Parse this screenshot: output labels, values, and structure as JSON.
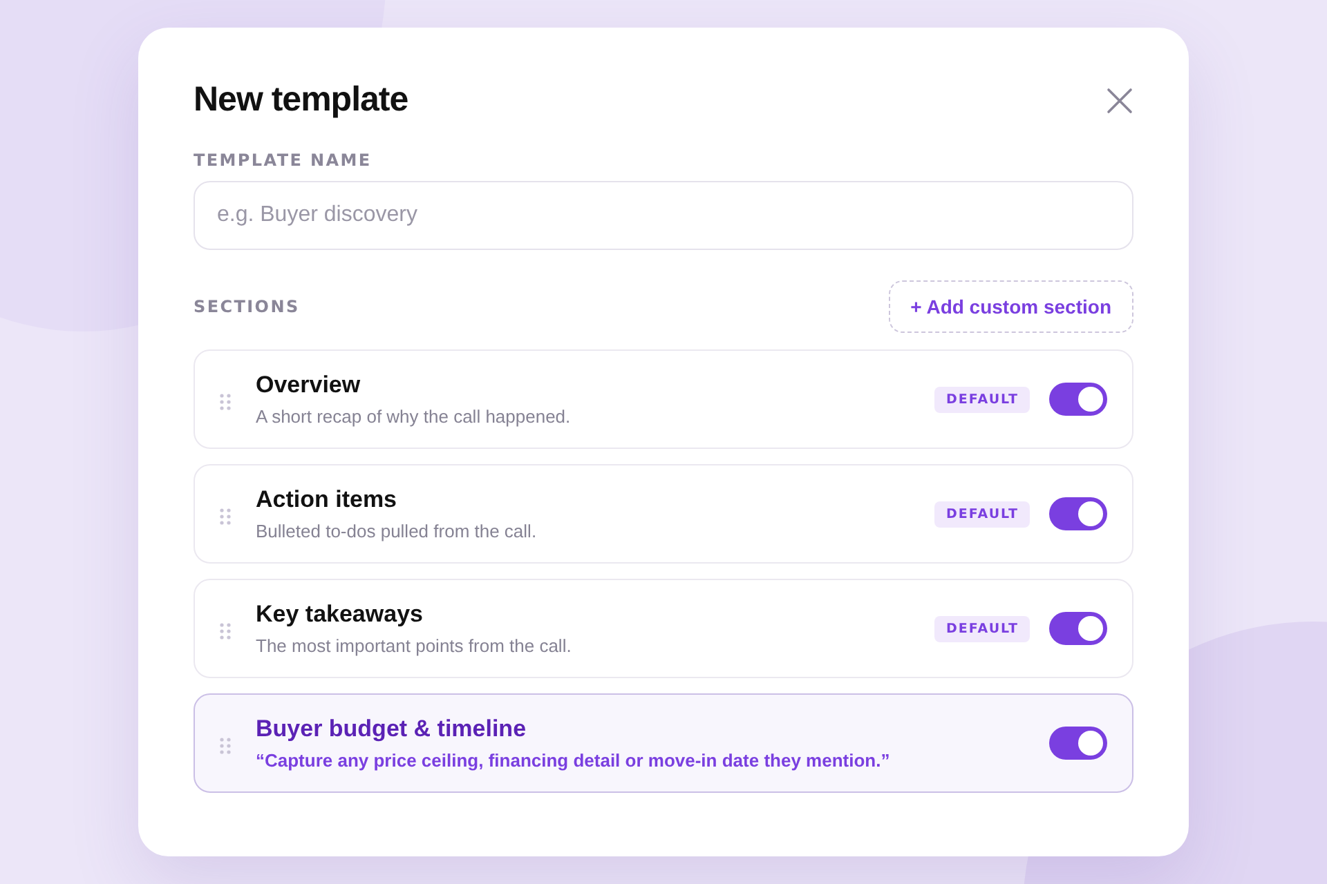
{
  "dialog": {
    "title": "New template"
  },
  "template_name": {
    "label": "TEMPLATE NAME",
    "placeholder": "e.g. Buyer discovery"
  },
  "sections_header": {
    "label": "SECTIONS",
    "add_button": "+ Add custom section"
  },
  "sections": [
    {
      "kind": "default",
      "title": "Overview",
      "description": "A short recap of why the call happened.",
      "badge": "DEFAULT",
      "on": true
    },
    {
      "kind": "default",
      "title": "Action items",
      "description": "Bulleted to-dos pulled from the call.",
      "badge": "DEFAULT",
      "on": true
    },
    {
      "kind": "default",
      "title": "Key takeaways",
      "description": "The most important points from the call.",
      "badge": "DEFAULT",
      "on": true
    },
    {
      "kind": "custom",
      "title": "Buyer budget & timeline",
      "description": "“Capture any price ceiling, financing detail or move-in date they mention.”",
      "on": true
    }
  ]
}
